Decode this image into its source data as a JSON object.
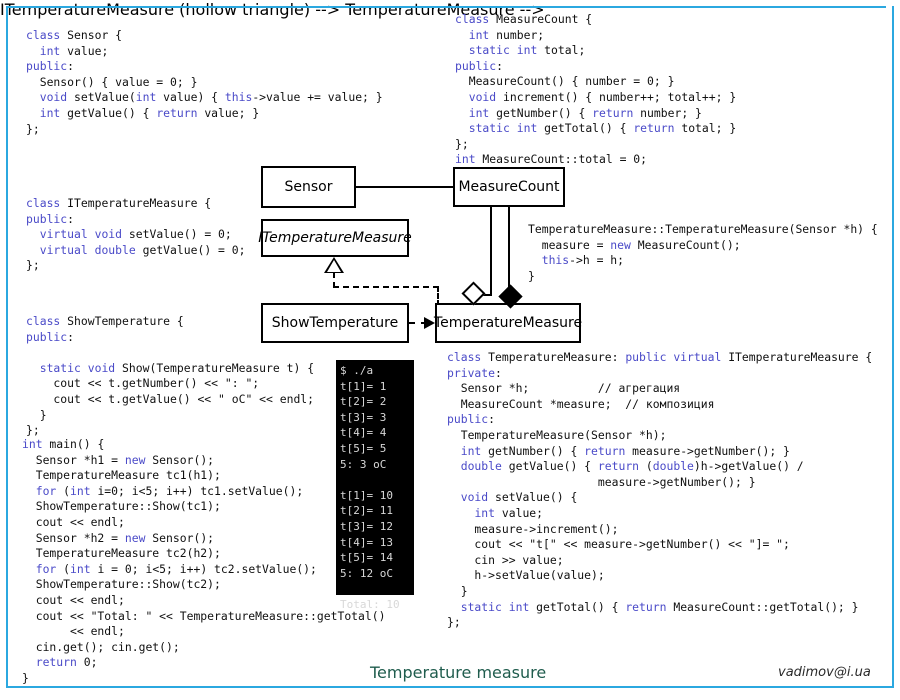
{
  "frame": {
    "border_color": "#2ba8e0"
  },
  "caption": {
    "title": "Temperature measure",
    "author": "vadimov@i.ua"
  },
  "code_blocks": {
    "sensor_class": "class Sensor {\n  int value;\npublic:\n  Sensor() { value = 0; }\n  void setValue(int value) { this->value += value; }\n  int getValue() { return value; }\n};",
    "measure_count_class": "class MeasureCount {\n  int number;\n  static int total;\npublic:\n  MeasureCount() { number = 0; }\n  void increment() { number++; total++; }\n  int getNumber() { return number; }\n  static int getTotal() { return total; }\n};\nint MeasureCount::total = 0;",
    "itemperature_class": "class ITemperatureMeasure {\npublic:\n  virtual void setValue() = 0;\n  virtual double getValue() = 0;\n};",
    "constructor_def": "TemperatureMeasure::TemperatureMeasure(Sensor *h) {\n  measure = new MeasureCount();\n  this->h = h;\n}",
    "show_temperature_class": "class ShowTemperature {\npublic:\n\n  static void Show(TemperatureMeasure t) {\n    cout << t.getNumber() << \": \";\n    cout << t.getValue() << \" oC\" << endl;\n  }\n};",
    "main_function": "int main() {\n  Sensor *h1 = new Sensor();\n  TemperatureMeasure tc1(h1);\n  for (int i=0; i<5; i++) tc1.setValue();\n  ShowTemperature::Show(tc1);\n  cout << endl;\n  Sensor *h2 = new Sensor();\n  TemperatureMeasure tc2(h2);\n  for (int i = 0; i<5; i++) tc2.setValue();\n  ShowTemperature::Show(tc2);\n  cout << endl;\n  cout << \"Total: \" << TemperatureMeasure::getTotal()\n       << endl;\n  cin.get(); cin.get();\n  return 0;\n}",
    "temperature_measure_class": "class TemperatureMeasure: public virtual ITemperatureMeasure {\nprivate:\n  Sensor *h;          // агрегация\n  MeasureCount *measure;  // композиция\npublic:\n  TemperatureMeasure(Sensor *h);\n  int getNumber() { return measure->getNumber(); }\n  double getValue() { return (double)h->getValue() /\n                      measure->getNumber(); }\n  void setValue() {\n    int value;\n    measure->increment();\n    cout << \"t[\" << measure->getNumber() << \"]= \";\n    cin >> value;\n    h->setValue(value);\n  }\n  static int getTotal() { return MeasureCount::getTotal(); }\n};"
  },
  "uml": {
    "sensor": "Sensor",
    "itemperature_measure": "ITemperatureMeasure",
    "measure_count": "MeasureCount",
    "show_temperature": "ShowTemperature",
    "temperature_measure": "TemperatureMeasure"
  },
  "terminal": {
    "lines": [
      "$ ./a",
      "t[1]= 1",
      "t[2]= 2",
      "t[3]= 3",
      "t[4]= 4",
      "t[5]= 5",
      "5: 3 oC",
      "",
      "t[1]= 10",
      "t[2]= 11",
      "t[3]= 12",
      "t[4]= 13",
      "t[5]= 14",
      "5: 12 oC",
      "",
      "Total: 10"
    ]
  }
}
